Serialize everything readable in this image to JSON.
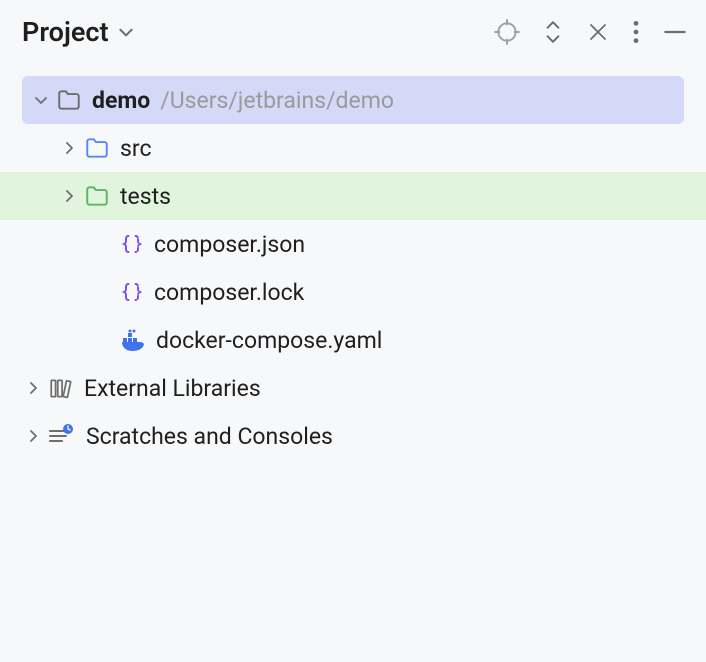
{
  "header": {
    "title": "Project"
  },
  "tree": {
    "root": {
      "name": "demo",
      "path": "/Users/jetbrains/demo"
    },
    "src": {
      "label": "src"
    },
    "tests": {
      "label": "tests"
    },
    "composer_json": {
      "label": "composer.json"
    },
    "composer_lock": {
      "label": "composer.lock"
    },
    "docker_compose": {
      "label": "docker-compose.yaml"
    },
    "external_libs": {
      "label": "External Libraries"
    },
    "scratches": {
      "label": "Scratches and Consoles"
    }
  },
  "icons": {
    "target": "target-icon",
    "expand_collapse": "expand-collapse-icon",
    "collapse_all": "collapse-all-icon",
    "more": "more-icon",
    "minimize": "minimize-icon"
  },
  "colors": {
    "folder_gray": "#6e6e6e",
    "folder_blue": "#548af7",
    "folder_green": "#5fb365",
    "json_purple": "#834df0",
    "docker_blue": "#4073e9",
    "selection_bg": "#d4d9f7",
    "highlight_bg": "#e1f4de"
  }
}
